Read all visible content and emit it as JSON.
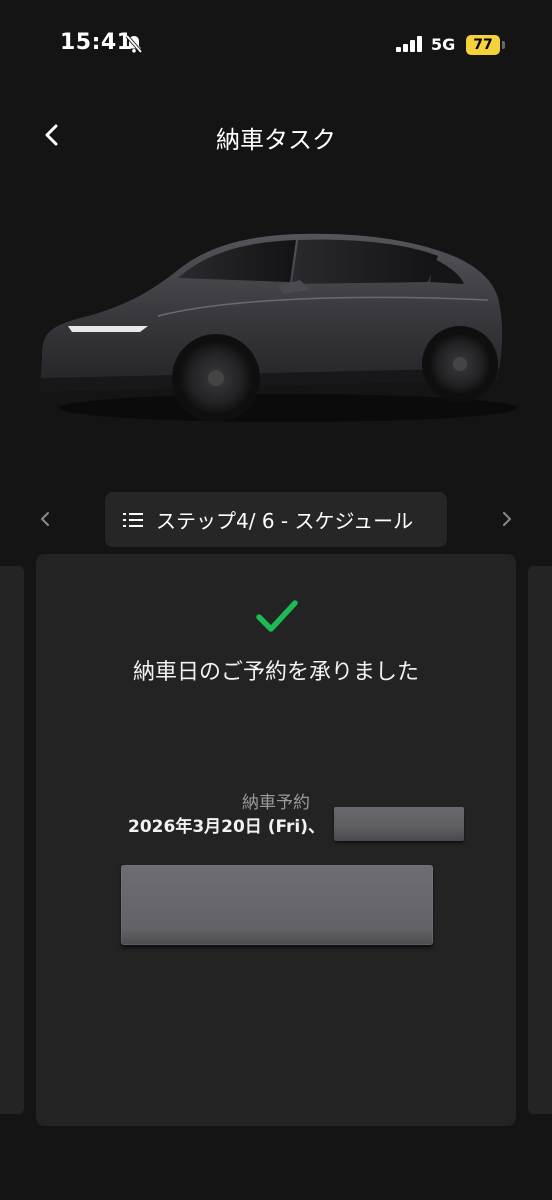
{
  "status_bar": {
    "time": "15:41",
    "network": "5G",
    "battery": "77",
    "battery_color": "#f5d23b"
  },
  "header": {
    "title": "納車タスク",
    "back_icon": "chevron-left-icon"
  },
  "hero": {
    "image": "car-image"
  },
  "stepper": {
    "label": "ステップ4/ 6 - スケジュール",
    "list_icon": "list-icon"
  },
  "card": {
    "confirmation": "納車日のご予約を承りました",
    "reservation_label": "納車予約",
    "reservation_date": "2026年3月20日 (Fri)、",
    "check_color": "#1db954"
  }
}
